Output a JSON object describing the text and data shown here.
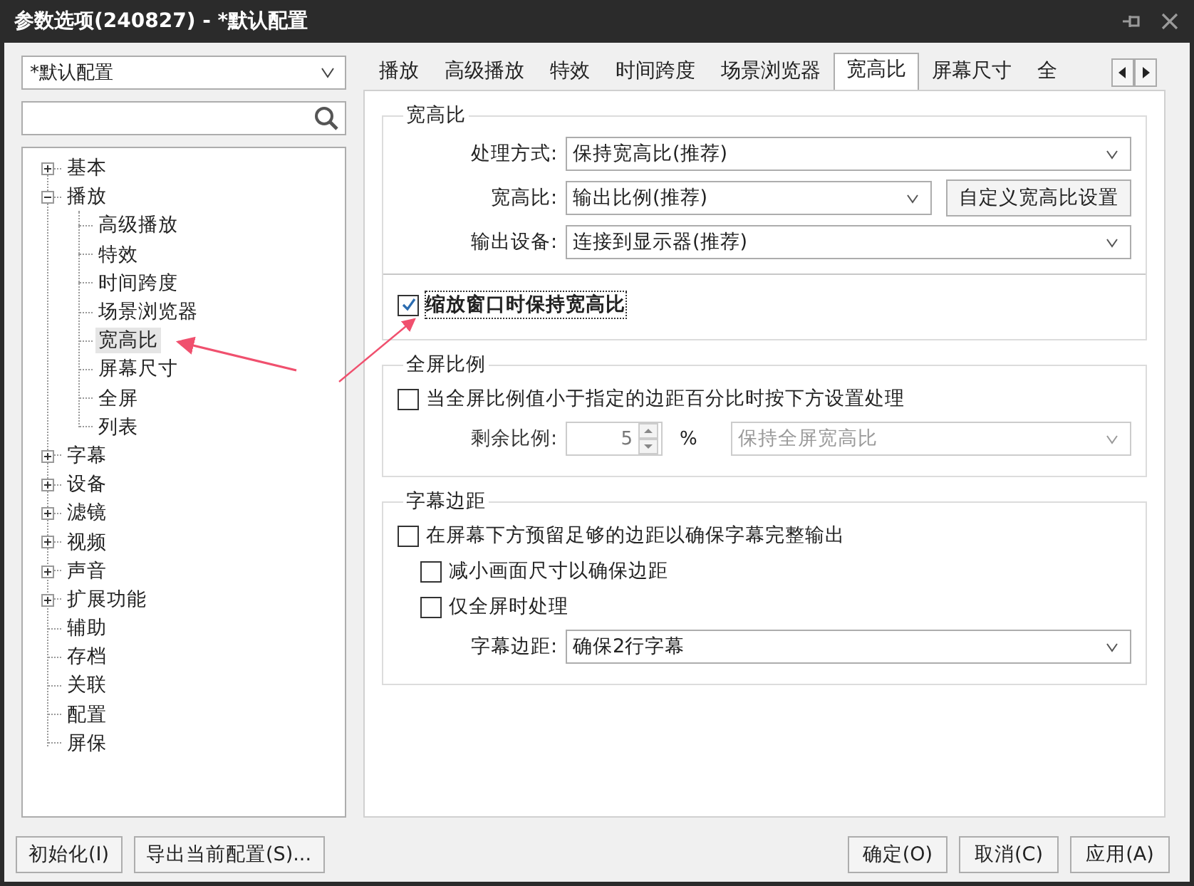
{
  "window": {
    "title": "参数选项(240827) - *默认配置"
  },
  "profile_select": {
    "value": "*默认配置"
  },
  "tree": [
    {
      "label": "基本",
      "kind": "folder",
      "expanded": false,
      "selected": false
    },
    {
      "label": "播放",
      "kind": "folder",
      "expanded": true,
      "selected": false,
      "children": [
        {
          "label": "高级播放",
          "selected": false
        },
        {
          "label": "特效",
          "selected": false
        },
        {
          "label": "时间跨度",
          "selected": false
        },
        {
          "label": "场景浏览器",
          "selected": false
        },
        {
          "label": "宽高比",
          "selected": true
        },
        {
          "label": "屏幕尺寸",
          "selected": false
        },
        {
          "label": "全屏",
          "selected": false
        },
        {
          "label": "列表",
          "selected": false
        }
      ]
    },
    {
      "label": "字幕",
      "kind": "folder",
      "expanded": false,
      "selected": false
    },
    {
      "label": "设备",
      "kind": "folder",
      "expanded": false,
      "selected": false
    },
    {
      "label": "滤镜",
      "kind": "folder",
      "expanded": false,
      "selected": false
    },
    {
      "label": "视频",
      "kind": "folder",
      "expanded": false,
      "selected": false
    },
    {
      "label": "声音",
      "kind": "folder",
      "expanded": false,
      "selected": false
    },
    {
      "label": "扩展功能",
      "kind": "folder",
      "expanded": false,
      "selected": false
    },
    {
      "label": "辅助",
      "kind": "leaf",
      "selected": false
    },
    {
      "label": "存档",
      "kind": "leaf",
      "selected": false
    },
    {
      "label": "关联",
      "kind": "leaf",
      "selected": false
    },
    {
      "label": "配置",
      "kind": "leaf",
      "selected": false
    },
    {
      "label": "屏保",
      "kind": "leaf",
      "selected": false
    }
  ],
  "tabs": [
    {
      "label": "播放",
      "selected": false
    },
    {
      "label": "高级播放",
      "selected": false
    },
    {
      "label": "特效",
      "selected": false
    },
    {
      "label": "时间跨度",
      "selected": false
    },
    {
      "label": "场景浏览器",
      "selected": false
    },
    {
      "label": "宽高比",
      "selected": true
    },
    {
      "label": "屏幕尺寸",
      "selected": false
    },
    {
      "label": "全",
      "selected": false
    }
  ],
  "groups": [
    {
      "title": "宽高比",
      "rows": [
        {
          "kind": "select",
          "label": "处理方式:",
          "value": "保持宽高比(推荐)"
        },
        {
          "kind": "select",
          "label": "宽高比:",
          "value": "输出比例(推荐)",
          "button": "自定义宽高比设置"
        },
        {
          "kind": "select",
          "label": "输出设备:",
          "value": "连接到显示器(推荐)"
        },
        {
          "kind": "divider"
        },
        {
          "kind": "checkbox",
          "label": "缩放窗口时保持宽高比",
          "checked": true,
          "focused": true
        }
      ]
    },
    {
      "title": "全屏比例",
      "rows": [
        {
          "kind": "checkbox",
          "label": "当全屏比例值小于指定的边距百分比时按下方设置处理",
          "checked": false,
          "focused": false
        },
        {
          "kind": "spinner",
          "label": "剩余比例:",
          "value": "5",
          "unit": "%",
          "select": "保持全屏宽高比",
          "disabled": true
        }
      ]
    },
    {
      "title": "字幕边距",
      "rows": [
        {
          "kind": "checkbox",
          "label": "在屏幕下方预留足够的边距以确保字幕完整输出",
          "checked": false,
          "focused": false,
          "children": [
            {
              "label": "减小画面尺寸以确保边距",
              "checked": false,
              "focused": false
            },
            {
              "label": "仅全屏时处理",
              "checked": false,
              "focused": false
            }
          ]
        },
        {
          "kind": "select",
          "label": "字幕边距:",
          "value": "确保2行字幕"
        }
      ]
    }
  ],
  "left_buttons": [
    "初始化(I)",
    "导出当前配置(S)..."
  ],
  "right_buttons": [
    "确定(O)",
    "取消(C)",
    "应用(A)"
  ]
}
